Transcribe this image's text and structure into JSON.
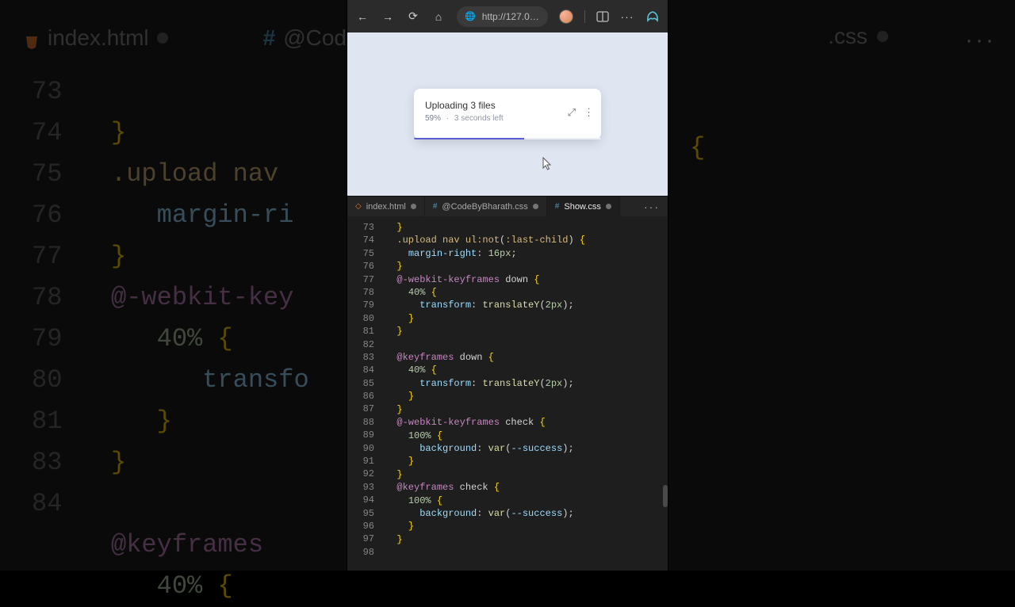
{
  "background": {
    "tabs": [
      {
        "icon_color": "#e37933",
        "label": "index.html"
      },
      {
        "icon_color": "#519aba",
        "label": "@Code",
        "prefixed": "#"
      }
    ],
    "more": "···",
    "gutter": [
      "73",
      "74",
      "75",
      "76",
      "77",
      "78",
      "79",
      "80",
      "81",
      "",
      "83",
      "84"
    ],
    "right_tab_label": ".css"
  },
  "chrome": {
    "url": "http://127.0.0.1…",
    "icons": {
      "back": "←",
      "forward": "→",
      "reload": "⟳",
      "home": "⌂",
      "globe": "🌐"
    }
  },
  "upload": {
    "title": "Uploading 3 files",
    "percent": "59%",
    "sep": "·",
    "remaining": "3 seconds left",
    "expand": "⤢",
    "menu": "⋮",
    "progress_pct": 59
  },
  "tabs": [
    {
      "icon": "◇",
      "icon_color": "#e37933",
      "label": "index.html",
      "active": false,
      "dirty": true
    },
    {
      "icon": "#",
      "icon_color": "#519aba",
      "label": "@CodeByBharath.css",
      "active": false,
      "dirty": true
    },
    {
      "icon": "#",
      "icon_color": "#519aba",
      "label": "Show.css",
      "active": true,
      "dirty": true
    }
  ],
  "tab_more": "···",
  "editor": {
    "first_line_no": 73,
    "lines": [
      {
        "n": 73,
        "html": "  <span class='c-brace'>}</span>"
      },
      {
        "n": 74,
        "html": "  <span class='c-sel'>.upload nav ul</span><span class='c-pseudo'>:not</span><span class='c-punc'>(</span><span class='c-pseudo'>:last-child</span><span class='c-punc'>)</span> <span class='c-brace'>{</span>"
      },
      {
        "n": 75,
        "html": "    <span class='c-prop'>margin-right</span><span class='c-punc'>:</span> <span class='c-num'>16px</span><span class='c-punc'>;</span>"
      },
      {
        "n": 76,
        "html": "  <span class='c-brace'>}</span>"
      },
      {
        "n": 77,
        "html": "  <span class='c-at'>@-webkit-keyframes</span> <span class='c-ident'>down</span> <span class='c-brace'>{</span>"
      },
      {
        "n": 78,
        "html": "    <span class='c-num'>40%</span> <span class='c-brace'>{</span>"
      },
      {
        "n": 79,
        "html": "      <span class='c-prop'>transform</span><span class='c-punc'>:</span> <span class='c-func'>translateY</span><span class='c-punc'>(</span><span class='c-num'>2px</span><span class='c-punc'>);</span>"
      },
      {
        "n": 80,
        "html": "    <span class='c-brace'>}</span>"
      },
      {
        "n": 81,
        "html": "  <span class='c-brace'>}</span>"
      },
      {
        "n": 82,
        "html": ""
      },
      {
        "n": 83,
        "html": "  <span class='c-at'>@keyframes</span> <span class='c-ident'>down</span> <span class='c-brace'>{</span>"
      },
      {
        "n": 84,
        "html": "    <span class='c-num'>40%</span> <span class='c-brace'>{</span>"
      },
      {
        "n": 85,
        "html": "      <span class='c-prop'>transform</span><span class='c-punc'>:</span> <span class='c-func'>translateY</span><span class='c-punc'>(</span><span class='c-num'>2px</span><span class='c-punc'>);</span>"
      },
      {
        "n": 86,
        "html": "    <span class='c-brace'>}</span>"
      },
      {
        "n": 87,
        "html": "  <span class='c-brace'>}</span>"
      },
      {
        "n": 88,
        "html": "  <span class='c-at'>@-webkit-keyframes</span> <span class='c-ident'>check</span> <span class='c-brace'>{</span>"
      },
      {
        "n": 89,
        "html": "    <span class='c-num'>100%</span> <span class='c-brace'>{</span>"
      },
      {
        "n": 90,
        "html": "      <span class='c-prop'>background</span><span class='c-punc'>:</span> <span class='c-func'>var</span><span class='c-punc'>(</span><span class='c-var'>--success</span><span class='c-punc'>);</span>"
      },
      {
        "n": 91,
        "html": "    <span class='c-brace'>}</span>"
      },
      {
        "n": 92,
        "html": "  <span class='c-brace'>}</span>"
      },
      {
        "n": 93,
        "html": "  <span class='c-at'>@keyframes</span> <span class='c-ident'>check</span> <span class='c-brace'>{</span>"
      },
      {
        "n": 94,
        "html": "    <span class='c-num'>100%</span> <span class='c-brace'>{</span>"
      },
      {
        "n": 95,
        "html": "      <span class='c-prop'>background</span><span class='c-punc'>:</span> <span class='c-func'>var</span><span class='c-punc'>(</span><span class='c-var'>--success</span><span class='c-punc'>);</span>"
      },
      {
        "n": 96,
        "html": "    <span class='c-brace'>}</span>"
      },
      {
        "n": 97,
        "html": "  <span class='c-brace'>}</span>"
      },
      {
        "n": 98,
        "html": ""
      }
    ]
  }
}
